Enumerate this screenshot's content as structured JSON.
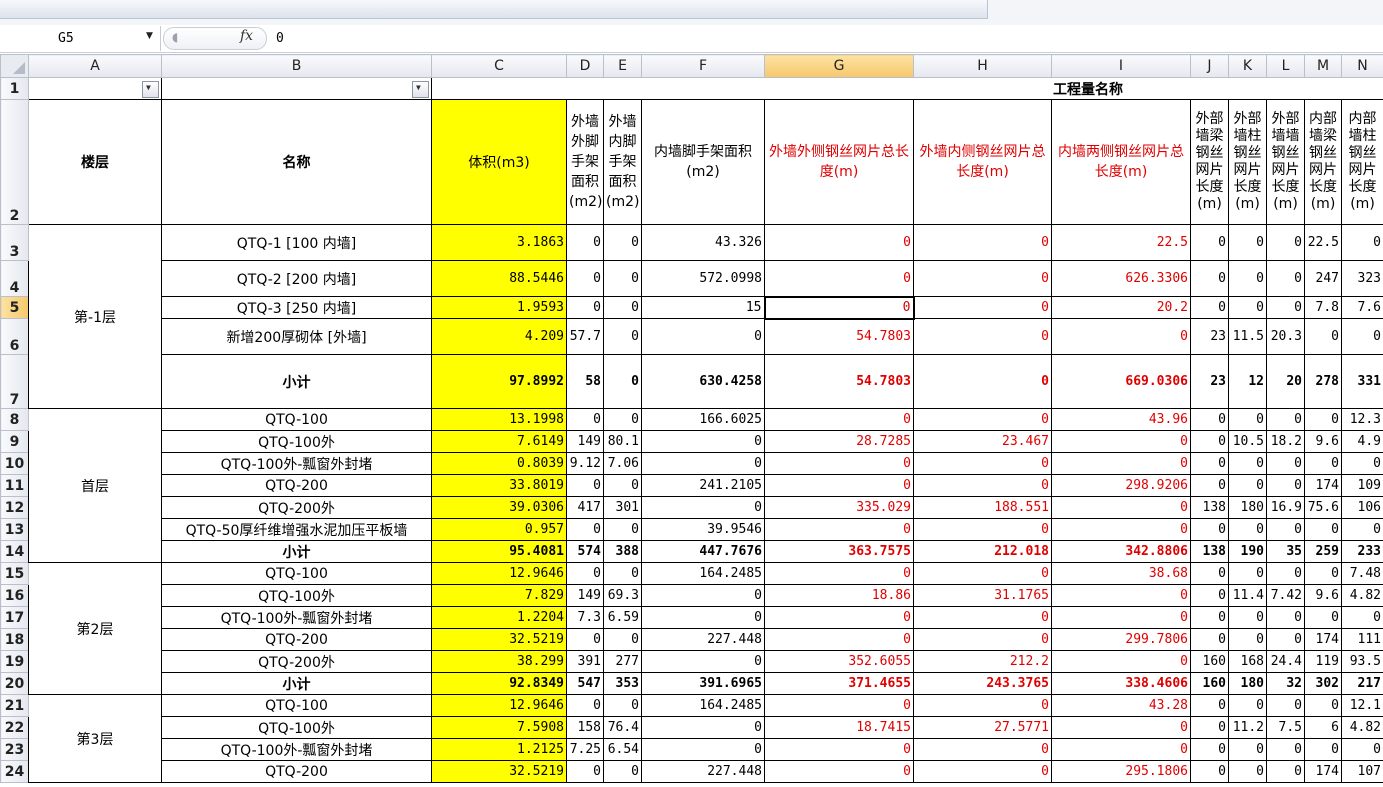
{
  "formula_bar": {
    "name_box": "G5",
    "fx": "𝑓x",
    "value": "0"
  },
  "columns": [
    "A",
    "B",
    "C",
    "D",
    "E",
    "F",
    "G",
    "H",
    "I",
    "J",
    "K",
    "L",
    "M",
    "N"
  ],
  "selected_column": "G",
  "selected_row": "5",
  "header_group": "工程量名称",
  "headers": {
    "A": "楼层",
    "B": "名称",
    "C": "体积(m3)",
    "D": "外墙外脚手架面积(m2)",
    "E": "外墙内脚手架面积(m2)",
    "F": "内墙脚手架面积(m2)",
    "G": "外墙外侧钢丝网片总长度(m)",
    "H": "外墙内侧钢丝网片总长度(m)",
    "I": "内墙两侧钢丝网片总长度(m)",
    "J": "外部墙梁钢丝网片长度(m)",
    "K": "外部墙柱钢丝网片长度(m)",
    "L": "外部墙墙钢丝网片长度(m)",
    "M": "内部墙梁钢丝网片长度(m)",
    "N": "内部墙柱钢丝网片长度(m)"
  },
  "floors": [
    {
      "name": "第-1层",
      "rows": [
        {
          "rn": "3",
          "name": "QTQ-1 [100 内墙]",
          "c": "3.1863",
          "d": "0",
          "e": "0",
          "f": "43.326",
          "g": "0",
          "h": "0",
          "i": "22.5",
          "j": "0",
          "k": "0",
          "l": "0",
          "m": "22.5",
          "n": "0"
        },
        {
          "rn": "4",
          "name": "QTQ-2 [200 内墙]",
          "c": "88.5446",
          "d": "0",
          "e": "0",
          "f": "572.0998",
          "g": "0",
          "h": "0",
          "i": "626.3306",
          "j": "0",
          "k": "0",
          "l": "0",
          "m": "247",
          "n": "323"
        },
        {
          "rn": "5",
          "name": "QTQ-3 [250 内墙]",
          "c": "1.9593",
          "d": "0",
          "e": "0",
          "f": "15",
          "g": "0",
          "h": "0",
          "i": "20.2",
          "j": "0",
          "k": "0",
          "l": "0",
          "m": "7.8",
          "n": "7.6"
        },
        {
          "rn": "6",
          "name": "新增200厚砌体 [外墙]",
          "c": "4.209",
          "d": "57.7",
          "e": "0",
          "f": "0",
          "g": "54.7803",
          "h": "0",
          "i": "0",
          "j": "23",
          "k": "11.5",
          "l": "20.3",
          "m": "0",
          "n": "0"
        }
      ],
      "subtotal": {
        "rn": "7",
        "name": "小计",
        "c": "97.8992",
        "d": "58",
        "e": "0",
        "f": "630.4258",
        "g": "54.7803",
        "h": "0",
        "i": "669.0306",
        "j": "23",
        "k": "12",
        "l": "20",
        "m": "278",
        "n": "331"
      }
    },
    {
      "name": "首层",
      "rows": [
        {
          "rn": "8",
          "name": "QTQ-100",
          "c": "13.1998",
          "d": "0",
          "e": "0",
          "f": "166.6025",
          "g": "0",
          "h": "0",
          "i": "43.96",
          "j": "0",
          "k": "0",
          "l": "0",
          "m": "0",
          "n": "12.3"
        },
        {
          "rn": "9",
          "name": "QTQ-100外",
          "c": "7.6149",
          "d": "149",
          "e": "80.1",
          "f": "0",
          "g": "28.7285",
          "h": "23.467",
          "i": "0",
          "j": "0",
          "k": "10.5",
          "l": "18.2",
          "m": "9.6",
          "n": "4.9"
        },
        {
          "rn": "10",
          "name": "QTQ-100外-瓢窗外封堵",
          "c": "0.8039",
          "d": "9.12",
          "e": "7.06",
          "f": "0",
          "g": "0",
          "h": "0",
          "i": "0",
          "j": "0",
          "k": "0",
          "l": "0",
          "m": "0",
          "n": "0"
        },
        {
          "rn": "11",
          "name": "QTQ-200",
          "c": "33.8019",
          "d": "0",
          "e": "0",
          "f": "241.2105",
          "g": "0",
          "h": "0",
          "i": "298.9206",
          "j": "0",
          "k": "0",
          "l": "0",
          "m": "174",
          "n": "109"
        },
        {
          "rn": "12",
          "name": "QTQ-200外",
          "c": "39.0306",
          "d": "417",
          "e": "301",
          "f": "0",
          "g": "335.029",
          "h": "188.551",
          "i": "0",
          "j": "138",
          "k": "180",
          "l": "16.9",
          "m": "75.6",
          "n": "106"
        },
        {
          "rn": "13",
          "name": "QTQ-50厚纤维增强水泥加压平板墙",
          "c": "0.957",
          "d": "0",
          "e": "0",
          "f": "39.9546",
          "g": "0",
          "h": "0",
          "i": "0",
          "j": "0",
          "k": "0",
          "l": "0",
          "m": "0",
          "n": "0"
        }
      ],
      "subtotal": {
        "rn": "14",
        "name": "小计",
        "c": "95.4081",
        "d": "574",
        "e": "388",
        "f": "447.7676",
        "g": "363.7575",
        "h": "212.018",
        "i": "342.8806",
        "j": "138",
        "k": "190",
        "l": "35",
        "m": "259",
        "n": "233"
      }
    },
    {
      "name": "第2层",
      "rows": [
        {
          "rn": "15",
          "name": "QTQ-100",
          "c": "12.9646",
          "d": "0",
          "e": "0",
          "f": "164.2485",
          "g": "0",
          "h": "0",
          "i": "38.68",
          "j": "0",
          "k": "0",
          "l": "0",
          "m": "0",
          "n": "7.48"
        },
        {
          "rn": "16",
          "name": "QTQ-100外",
          "c": "7.829",
          "d": "149",
          "e": "69.3",
          "f": "0",
          "g": "18.86",
          "h": "31.1765",
          "i": "0",
          "j": "0",
          "k": "11.4",
          "l": "7.42",
          "m": "9.6",
          "n": "4.82"
        },
        {
          "rn": "17",
          "name": "QTQ-100外-瓢窗外封堵",
          "c": "1.2204",
          "d": "7.3",
          "e": "6.59",
          "f": "0",
          "g": "0",
          "h": "0",
          "i": "0",
          "j": "0",
          "k": "0",
          "l": "0",
          "m": "0",
          "n": "0"
        },
        {
          "rn": "18",
          "name": "QTQ-200",
          "c": "32.5219",
          "d": "0",
          "e": "0",
          "f": "227.448",
          "g": "0",
          "h": "0",
          "i": "299.7806",
          "j": "0",
          "k": "0",
          "l": "0",
          "m": "174",
          "n": "111"
        },
        {
          "rn": "19",
          "name": "QTQ-200外",
          "c": "38.299",
          "d": "391",
          "e": "277",
          "f": "0",
          "g": "352.6055",
          "h": "212.2",
          "i": "0",
          "j": "160",
          "k": "168",
          "l": "24.4",
          "m": "119",
          "n": "93.5"
        }
      ],
      "subtotal": {
        "rn": "20",
        "name": "小计",
        "c": "92.8349",
        "d": "547",
        "e": "353",
        "f": "391.6965",
        "g": "371.4655",
        "h": "243.3765",
        "i": "338.4606",
        "j": "160",
        "k": "180",
        "l": "32",
        "m": "302",
        "n": "217"
      }
    },
    {
      "name": "第3层",
      "rows": [
        {
          "rn": "21",
          "name": "QTQ-100",
          "c": "12.9646",
          "d": "0",
          "e": "0",
          "f": "164.2485",
          "g": "0",
          "h": "0",
          "i": "43.28",
          "j": "0",
          "k": "0",
          "l": "0",
          "m": "0",
          "n": "12.1"
        },
        {
          "rn": "22",
          "name": "QTQ-100外",
          "c": "7.5908",
          "d": "158",
          "e": "76.4",
          "f": "0",
          "g": "18.7415",
          "h": "27.5771",
          "i": "0",
          "j": "0",
          "k": "11.2",
          "l": "7.5",
          "m": "6",
          "n": "4.82"
        },
        {
          "rn": "23",
          "name": "QTQ-100外-瓢窗外封堵",
          "c": "1.2125",
          "d": "7.25",
          "e": "6.54",
          "f": "0",
          "g": "0",
          "h": "0",
          "i": "0",
          "j": "0",
          "k": "0",
          "l": "0",
          "m": "0",
          "n": "0"
        },
        {
          "rn": "24",
          "name": "QTQ-200",
          "c": "32.5219",
          "d": "0",
          "e": "0",
          "f": "227.448",
          "g": "0",
          "h": "0",
          "i": "295.1806",
          "j": "0",
          "k": "0",
          "l": "0",
          "m": "174",
          "n": "107"
        }
      ]
    }
  ],
  "colors": {
    "highlight": "#ffff00",
    "red_text": "#e00000",
    "selected_header": "#f6c86c"
  }
}
